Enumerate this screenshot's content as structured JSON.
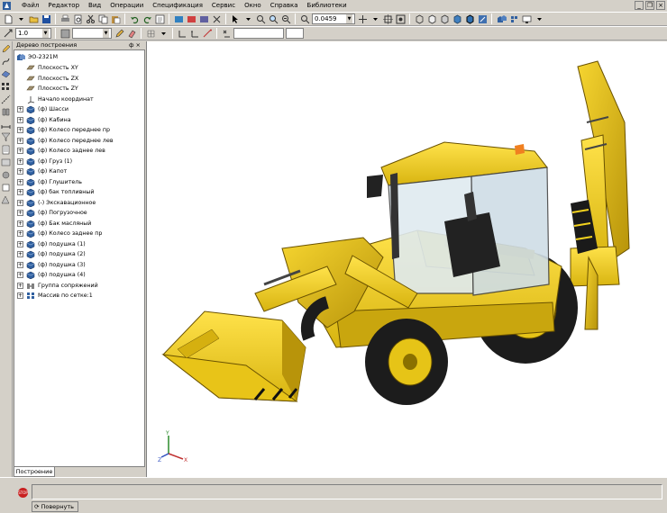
{
  "menubar": {
    "items": [
      "Файл",
      "Редактор",
      "Вид",
      "Операции",
      "Спецификация",
      "Сервис",
      "Окно",
      "Справка",
      "Библиотеки"
    ]
  },
  "toolbar": {
    "zoom_value": "0.0459",
    "step_value": "1.0"
  },
  "tree_panel": {
    "title": "Дерево построения",
    "root": "ЭО-2321М",
    "items": [
      {
        "label": "Плоскость XY",
        "type": "plane",
        "expandable": false
      },
      {
        "label": "Плоскость ZX",
        "type": "plane",
        "expandable": false
      },
      {
        "label": "Плоскость ZY",
        "type": "plane",
        "expandable": false
      },
      {
        "label": "Начало координат",
        "type": "origin",
        "expandable": false
      },
      {
        "label": "(ф) Шасси",
        "type": "part",
        "expandable": true
      },
      {
        "label": "(ф) Кабина",
        "type": "part",
        "expandable": true
      },
      {
        "label": "(ф) Колесо переднее пр",
        "type": "part",
        "expandable": true
      },
      {
        "label": "(ф) Колесо переднее лев",
        "type": "part",
        "expandable": true
      },
      {
        "label": "(ф) Колесо заднее лев",
        "type": "part",
        "expandable": true
      },
      {
        "label": "(ф) Груз (1)",
        "type": "part",
        "expandable": true
      },
      {
        "label": "(ф) Капот",
        "type": "part",
        "expandable": true
      },
      {
        "label": "(ф) Глушитель",
        "type": "part",
        "expandable": true
      },
      {
        "label": "(ф) бак топливный",
        "type": "part",
        "expandable": true
      },
      {
        "label": "(-) Экскавационное",
        "type": "part",
        "expandable": true
      },
      {
        "label": "(ф) Погрузочное",
        "type": "part",
        "expandable": true
      },
      {
        "label": "(ф) Бак масляный",
        "type": "part",
        "expandable": true
      },
      {
        "label": "(ф) Колесо заднее пр",
        "type": "part",
        "expandable": true
      },
      {
        "label": "(ф) подушка (1)",
        "type": "part",
        "expandable": true
      },
      {
        "label": "(ф) подушка (2)",
        "type": "part",
        "expandable": true
      },
      {
        "label": "(ф) подушка (3)",
        "type": "part",
        "expandable": true
      },
      {
        "label": "(ф) подушка (4)",
        "type": "part",
        "expandable": true
      },
      {
        "label": "Группа сопряжений",
        "type": "mates",
        "expandable": true
      },
      {
        "label": "Массив по сетке:1",
        "type": "array",
        "expandable": true
      }
    ],
    "tab_label": "Построение"
  },
  "viewport": {
    "model": "backhoe-loader",
    "body_color": "#f2d21e",
    "axes": {
      "y": "Y",
      "z": "Z",
      "x": "X"
    }
  },
  "status": {
    "rotate_button": "Повернуть"
  }
}
